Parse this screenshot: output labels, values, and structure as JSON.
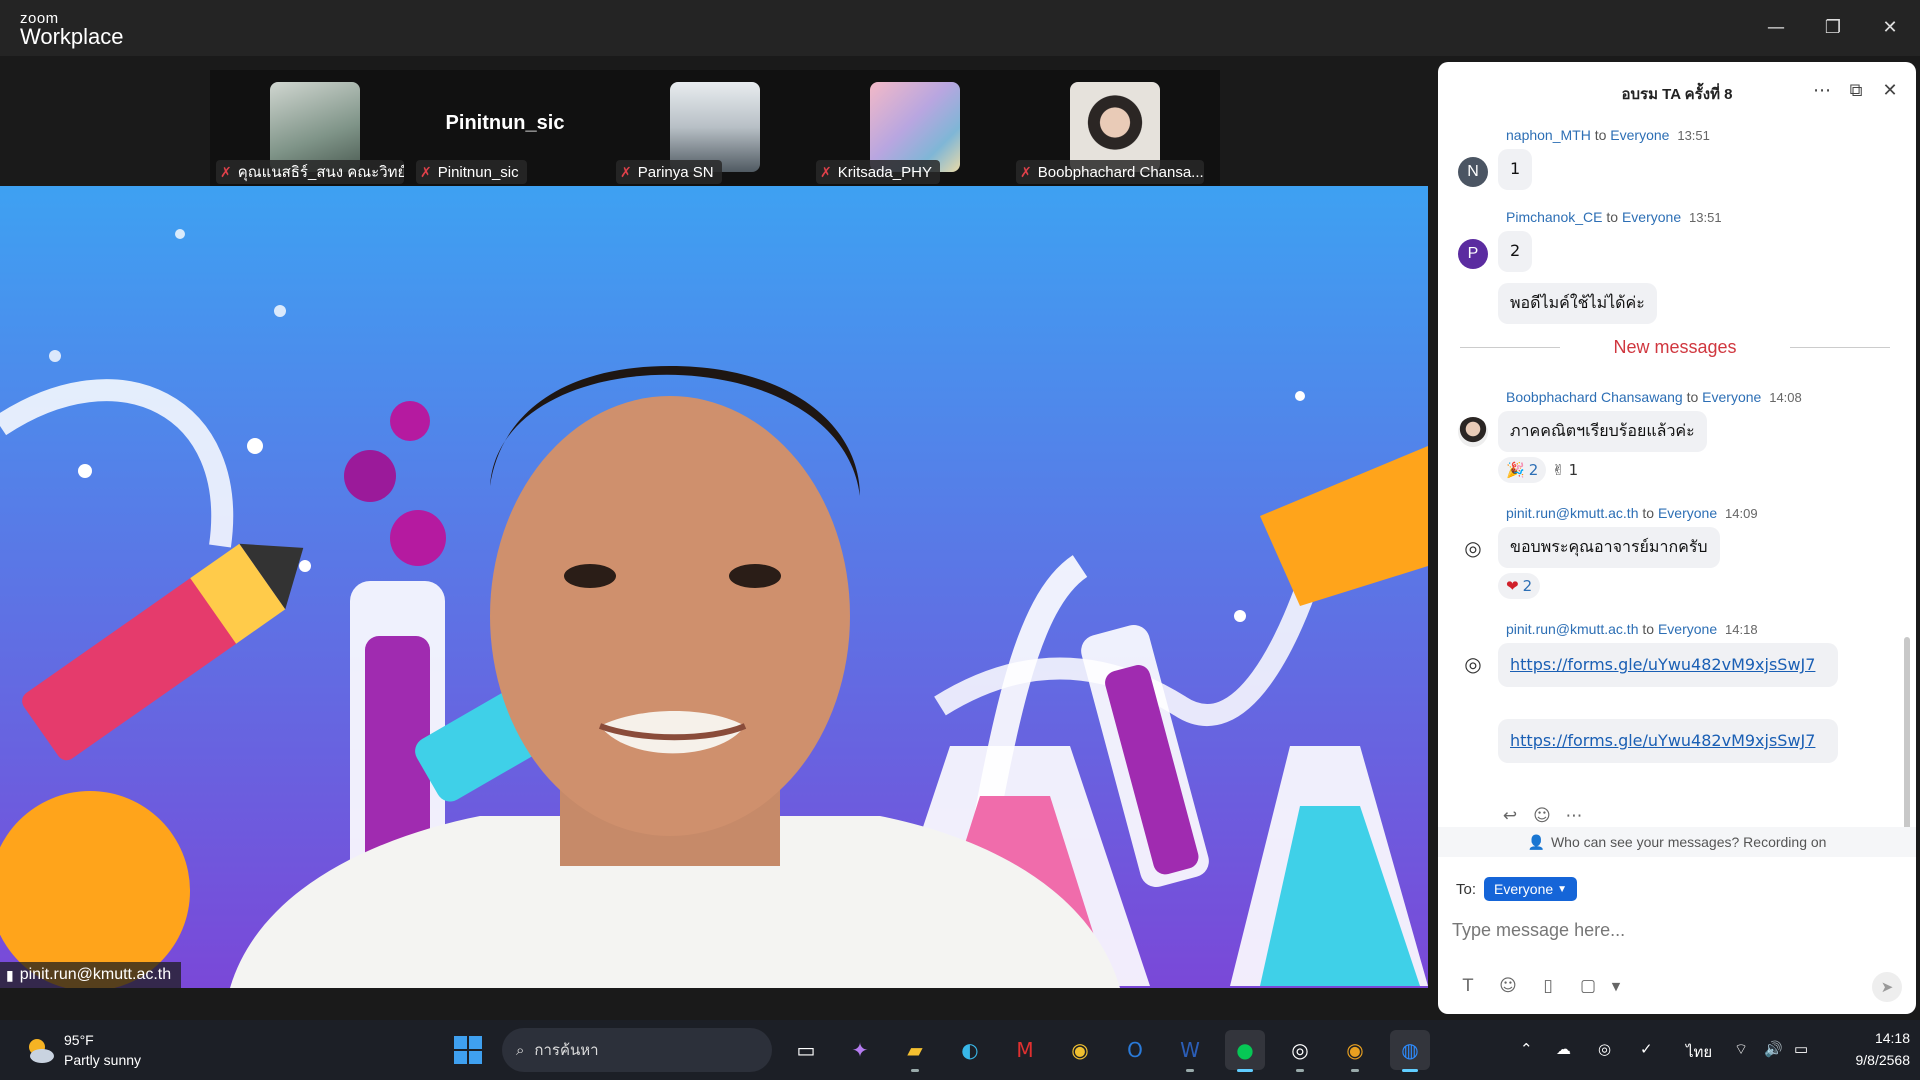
{
  "app": {
    "brand_small": "zoom",
    "brand_big": "Workplace",
    "accent": "#1565d8"
  },
  "window_controls": {
    "minimize": "—",
    "restore": "❐",
    "close": "✕"
  },
  "participants": [
    {
      "name": "คุณแนสธิร์_สนง คณะวิทย์",
      "muted": true,
      "has_video": true
    },
    {
      "name": "Pinitnun_sic",
      "muted": true,
      "has_video": false,
      "big_label": "Pinitnun_sic"
    },
    {
      "name": "Parinya SN",
      "muted": true,
      "has_video": true
    },
    {
      "name": "Kritsada_PHY",
      "muted": true,
      "has_video": true
    },
    {
      "name": "Boobphachard Chansa...",
      "muted": true,
      "has_video": true
    }
  ],
  "main_video": {
    "speaker_label": "pinit.run@kmutt.ac.th"
  },
  "chat": {
    "title": "อบรม TA ครั้งที่ 8",
    "icons": {
      "more": "more-icon",
      "popout": "popout-icon",
      "close": "close-icon"
    },
    "messages": [
      {
        "sender": "naphon_MTH",
        "to": "to",
        "target": "Everyone",
        "time": "13:51",
        "avatar_letter": "N",
        "avatar_color": "#4b5563",
        "bubbles": [
          "1"
        ]
      },
      {
        "sender": "Pimchanok_CE",
        "to": "to",
        "target": "Everyone",
        "time": "13:51",
        "avatar_letter": "P",
        "avatar_color": "#5b2ca0",
        "bubbles": [
          "2",
          "พอดีไมค์ใช้ไม่ได้ค่ะ"
        ]
      },
      {
        "sender": "Boobphachard Chansawang",
        "to": "to",
        "target": "Everyone",
        "time": "14:08",
        "bubbles": [
          "ภาคคณิตฯเรียบร้อยแล้วค่ะ"
        ],
        "reactions": [
          {
            "emoji": "🎉",
            "count": "2"
          },
          {
            "emoji": "✌",
            "count": "1"
          }
        ]
      },
      {
        "sender": "pinit.run@kmutt.ac.th",
        "to": "to",
        "target": "Everyone",
        "time": "14:09",
        "bubbles": [
          "ขอบพระคุณอาจารย์มากครับ"
        ],
        "reactions": [
          {
            "emoji": "❤",
            "count": "2"
          }
        ]
      },
      {
        "sender": "pinit.run@kmutt.ac.th",
        "to": "to",
        "target": "Everyone",
        "time": "14:18",
        "links": [
          "https://forms.gle/uYwu482vM9xjsSwJ7",
          "https://forms.gle/uYwu482vM9xjsSwJ7"
        ]
      }
    ],
    "new_messages_label": "New messages",
    "privacy_notice": "Who can see your messages? Recording on",
    "to_label": "To:",
    "to_value": "Everyone",
    "input_placeholder": "Type message here..."
  },
  "taskbar": {
    "weather_temp": "95°F",
    "weather_desc": "Partly sunny",
    "search_placeholder": "การค้นหา",
    "lang": "ไทย",
    "time": "14:18",
    "date": "9/8/2568"
  }
}
